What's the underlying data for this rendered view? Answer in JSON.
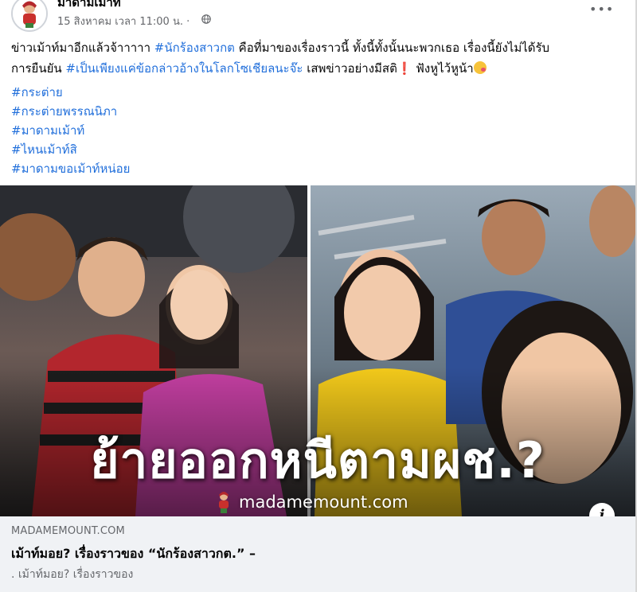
{
  "post": {
    "page_name": "มาดามเม้าท์",
    "timestamp": "15 สิงหาคม เวลา 11:00 น. ·",
    "icons": {
      "globe": "globe-icon",
      "more": "more-options-icon",
      "info": "info-icon"
    },
    "text": {
      "seg1": "ข่าวเม้าท์มาอีกแล้วจ้าาาาา ",
      "seg2": "#นักร้องสาวกต",
      "seg3": " คือที่มาของเรื่องราวนี้ ทั้งนี้ทั้งนั้นนะพวกเธอ เรื่องนี้ยังไม่ได้รับ",
      "seg4": "การยืนยัน ",
      "seg5": "#เป็นเพียงแค่ข้อกล่าวอ้างในโลกโซเชียลนะจ๊ะ",
      "seg6": "  เสพข่าวอย่างมีสติ",
      "seg7": "❗",
      "seg8": "  ฟังหูไว้หูน้า"
    },
    "hashtags": [
      "#กระต่าย",
      "#กระต่ายพรรณนิภา",
      "#มาดามเม้าท์",
      "#ไหนเม้าท์สิ",
      "#มาดามขอเม้าท์หน่อย"
    ]
  },
  "image": {
    "overlay_text": "ย้ายออกหนีตามผช.?",
    "watermark": "madamemount.com"
  },
  "link_preview": {
    "domain": "MADAMEMOUNT.COM",
    "title": "เม้าท์มอย? เรื่องราวของ “นักร้องสาวกต.” –",
    "description": ". เม้าท์มอย? เรื่องราวของ"
  },
  "colors": {
    "link": "#216fdb",
    "muted": "#65676b",
    "preview_bg": "#f0f2f5"
  }
}
